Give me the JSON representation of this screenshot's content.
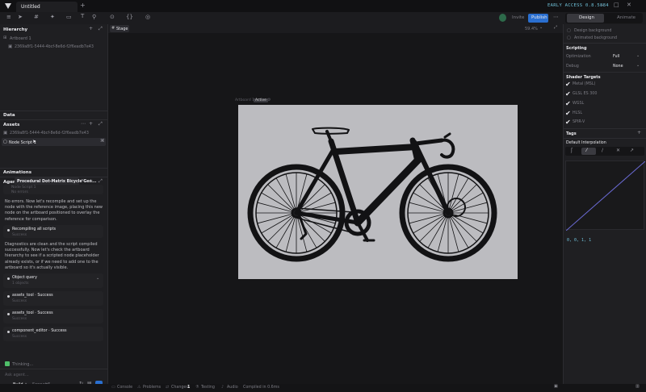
{
  "titlebar": {
    "tab": "Untitled",
    "early_access": "EARLY ACCESS 0.8.5884"
  },
  "toolbar": {
    "share_label": "Invite",
    "publish_label": "Publish",
    "tabs": [
      "Design",
      "Animate"
    ]
  },
  "hierarchy": {
    "title": "Hierarchy",
    "root": "Artboard 1",
    "child": "2369a8f1-5444-4bcf-8e6d-f2f6eadb7e43"
  },
  "data_panel": {
    "title": "Data",
    "assets_title": "Assets",
    "asset_item": "2369a8f1-5444-4bcf-8e6d-f2f6eadb7e43",
    "script_item": "Node Script 1"
  },
  "animations": {
    "title": "Animations"
  },
  "agent": {
    "tab_agent": "Agent",
    "tab_title": "Procedural Dot-Matrix Bicycle Gen...",
    "prev_item": "Node Script 1",
    "prev_status": "No errors",
    "msg1": "No errors. Now let's recompile and set up the node with the reference image, placing this new node on the artboard positioned to overlay the reference for comparison.",
    "step1_title": "Recompiling all scripts",
    "step1_status": "Success",
    "msg2": "Diagnostics are clean and the script compiled successfully. Now let's check the artboard hierarchy to see if a scripted node placeholder already exists, or if we need to add one to the artboard so it's actually visible.",
    "step2_title": "Object query",
    "step2_status": "1 objects",
    "step3_title": "assets_tool · Success",
    "step3_status": "Success",
    "step4_title": "assets_tool · Success",
    "step4_status": "Success",
    "step5_title": "component_editor · Success",
    "step5_status": "Success",
    "thinking": "Thinking...",
    "input_placeholder": "Ask agent...",
    "mode": "Build",
    "model": "Sonnet 5"
  },
  "stage": {
    "tab": "Stage",
    "zoom": "59.4%",
    "artboard_label": "Artboard 1",
    "artboard_tag": "Active",
    "artboard_color": "#bcbcc0",
    "bike_color": "#121214"
  },
  "right_panel": {
    "design_bg": "Design background",
    "animate_bg": "Animated background",
    "scripting_title": "Scripting",
    "optimization_label": "Optimization",
    "optimization_value": "Full",
    "debug_label": "Debug",
    "debug_value": "None",
    "shader_title": "Shader Targets",
    "shaders": [
      "Metal (MSL)",
      "GLSL ES 300",
      "WGSL",
      "HLSL",
      "SPIR-V"
    ],
    "tags_title": "Tags",
    "interp_title": "Default Interpolation",
    "curve_values": "0, 0, 1, 1"
  },
  "statusbar": {
    "items": [
      "Console",
      "Problems",
      "Changes",
      "Testing",
      "Audio",
      "Compiled in 0.6ms"
    ],
    "changes_count": "1"
  }
}
